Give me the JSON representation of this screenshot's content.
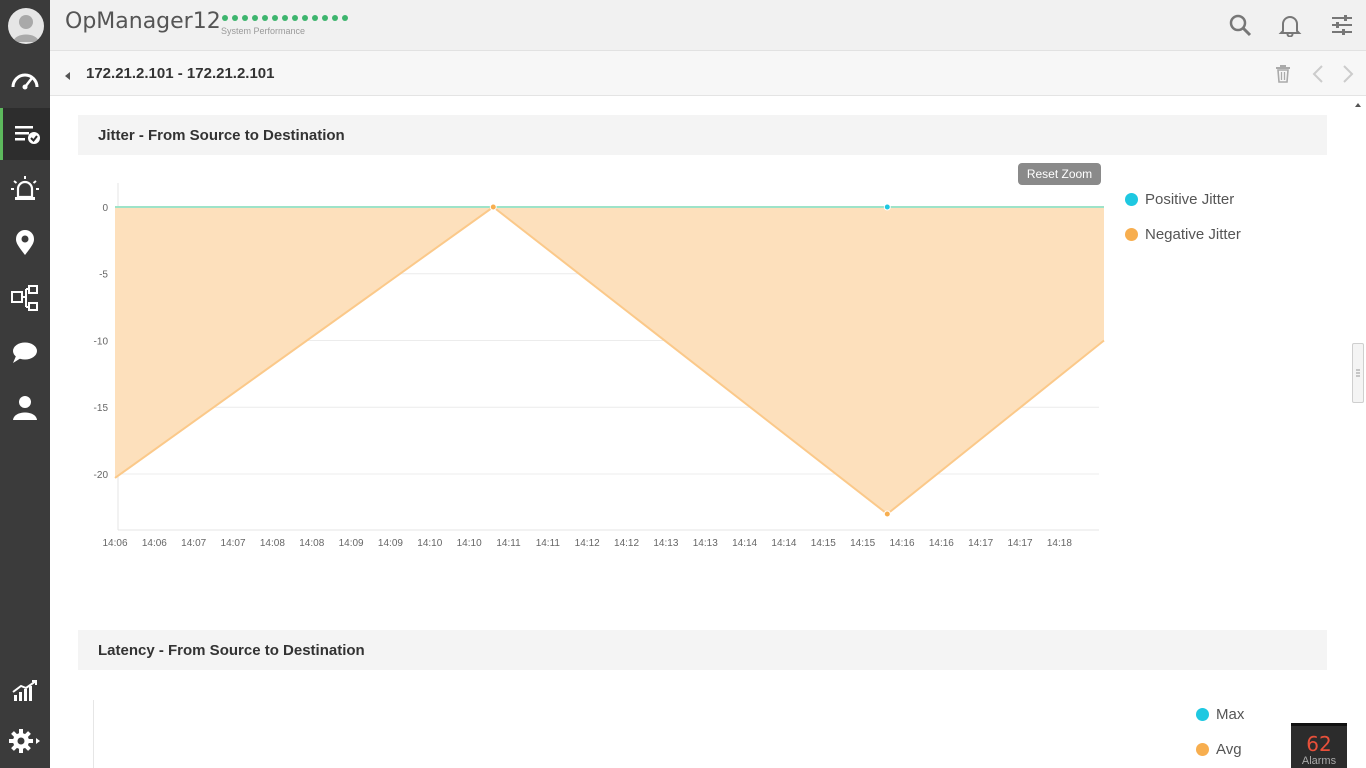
{
  "app": {
    "title": "OpManager12",
    "subtitle": "System Performance"
  },
  "sidebar": {
    "items": [
      {
        "name": "dashboard",
        "icon": "speedometer-icon"
      },
      {
        "name": "inventory",
        "icon": "list-check-icon",
        "active": true
      },
      {
        "name": "alarms",
        "icon": "siren-icon"
      },
      {
        "name": "maps",
        "icon": "location-pin-icon"
      },
      {
        "name": "workflow",
        "icon": "workflow-icon"
      },
      {
        "name": "chat",
        "icon": "chat-bubbles-icon"
      },
      {
        "name": "users",
        "icon": "user-icon"
      },
      {
        "name": "reports",
        "icon": "chart-trend-icon"
      },
      {
        "name": "settings",
        "icon": "gear-icon"
      }
    ]
  },
  "header": {
    "device_title": "172.21.2.101 - 172.21.2.101"
  },
  "jitter_section": {
    "title": "Jitter - From Source to Destination",
    "reset_zoom": "Reset Zoom"
  },
  "latency_section": {
    "title": "Latency - From Source to Destination",
    "legend": [
      "Max",
      "Avg"
    ]
  },
  "alarms": {
    "count": "62",
    "label": "Alarms"
  },
  "colors": {
    "positive": "#1ec8e1",
    "negative": "#f7ae4f",
    "negative_fill": "#fde0bc",
    "accent": "#5cb85c"
  },
  "chart_data": {
    "type": "area",
    "title": "",
    "xlabel": "",
    "ylabel": "",
    "x_ticks": [
      "14:06",
      "14:06",
      "14:07",
      "14:07",
      "14:08",
      "14:08",
      "14:09",
      "14:09",
      "14:10",
      "14:10",
      "14:11",
      "14:11",
      "14:12",
      "14:12",
      "14:13",
      "14:13",
      "14:14",
      "14:14",
      "14:15",
      "14:15",
      "14:16",
      "14:16",
      "14:17",
      "14:17",
      "14:18"
    ],
    "y_ticks": [
      0,
      -5,
      -10,
      -15,
      -20
    ],
    "ylim": [
      -24.2,
      1.2
    ],
    "xlim": [
      0,
      25.1
    ],
    "legend_position": "right",
    "grid": true,
    "series": [
      {
        "name": "Positive Jitter",
        "x": [
          0,
          9.6,
          19.6,
          25.1
        ],
        "values": [
          0,
          0,
          0,
          0
        ]
      },
      {
        "name": "Negative Jitter",
        "x": [
          0,
          9.6,
          19.6,
          25.1
        ],
        "values": [
          -20.3,
          0,
          -23,
          -10
        ]
      }
    ]
  }
}
